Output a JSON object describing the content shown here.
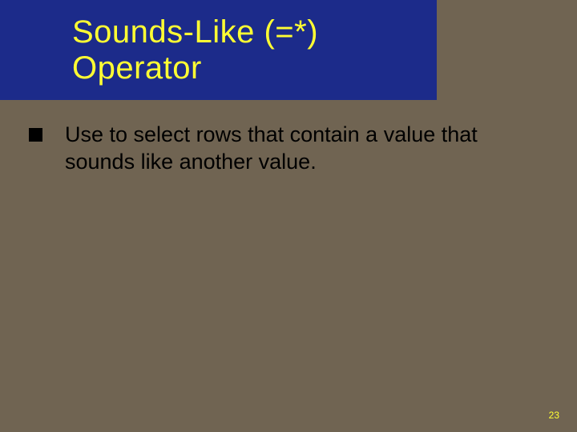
{
  "slide": {
    "title": "Sounds-Like (=*) Operator",
    "bullets": [
      {
        "text": "Use to select rows that contain a value that sounds like another value."
      }
    ],
    "page_number": "23"
  }
}
